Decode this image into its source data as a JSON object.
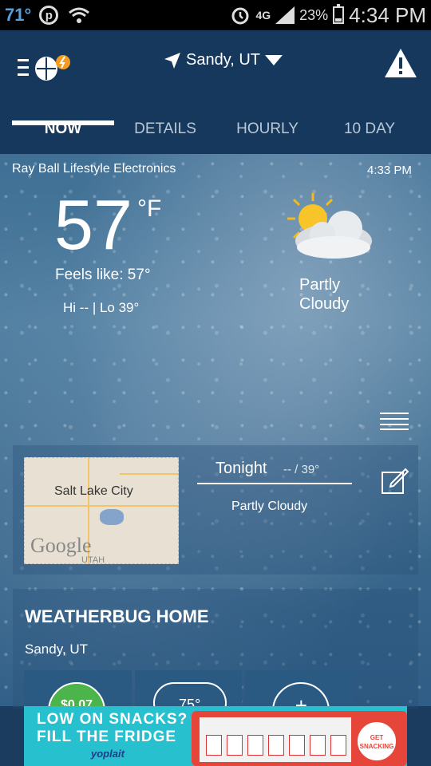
{
  "statusbar": {
    "temp": "71°",
    "network": "4G",
    "battery_pct": "23%",
    "time": "4:34 PM"
  },
  "appbar": {
    "location": "Sandy, UT",
    "tabs": [
      "NOW",
      "DETAILS",
      "HOURLY",
      "10 DAY"
    ],
    "active_tab": "NOW"
  },
  "current": {
    "sponsor": "Ray Ball Lifestyle Electronics",
    "obs_time": "4:33 PM",
    "temp": "57",
    "unit": "°F",
    "feels_like": "Feels like: 57°",
    "hilo": "Hi -- | Lo 39°",
    "condition": "Partly Cloudy"
  },
  "forecast": {
    "map_city": "Salt Lake City",
    "map_brand": "Google",
    "map_state": "UTAH",
    "period": "Tonight",
    "temps": "-- / 39°",
    "condition": "Partly Cloudy"
  },
  "home": {
    "title": "WEATHERBUG HOME",
    "location": "Sandy, UT",
    "price": "$0.07",
    "temp": "75°",
    "add": "+"
  },
  "ad": {
    "line1": "LOW ON SNACKS?",
    "line2": "FILL THE FRIDGE",
    "brand": "yoplait",
    "badge": "GET SNACKING"
  },
  "colors": {
    "appbar": "#16385c",
    "accent_green": "#4bb44a",
    "ad_bg": "#27c0cf"
  }
}
